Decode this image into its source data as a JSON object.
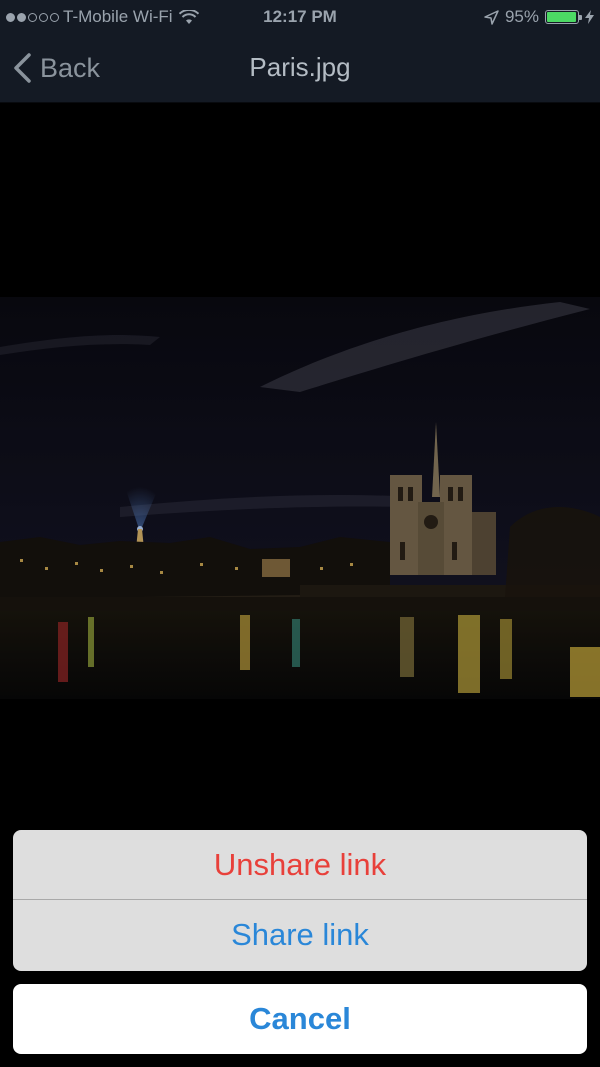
{
  "status_bar": {
    "carrier": "T-Mobile Wi-Fi",
    "time": "12:17 PM",
    "battery_text": "95%",
    "battery_level": 0.95,
    "signal_bars_filled": 2,
    "signal_bars_total": 5
  },
  "nav": {
    "back_label": "Back",
    "title": "Paris.jpg"
  },
  "action_sheet": {
    "unshare_label": "Unshare link",
    "share_label": "Share link",
    "cancel_label": "Cancel"
  },
  "colors": {
    "destructive": "#e8403a",
    "accent": "#2a87d8"
  },
  "icons": [
    "signal-dots-icon",
    "wifi-icon",
    "location-arrow-icon",
    "battery-icon",
    "charging-bolt-icon",
    "chevron-left-icon"
  ]
}
